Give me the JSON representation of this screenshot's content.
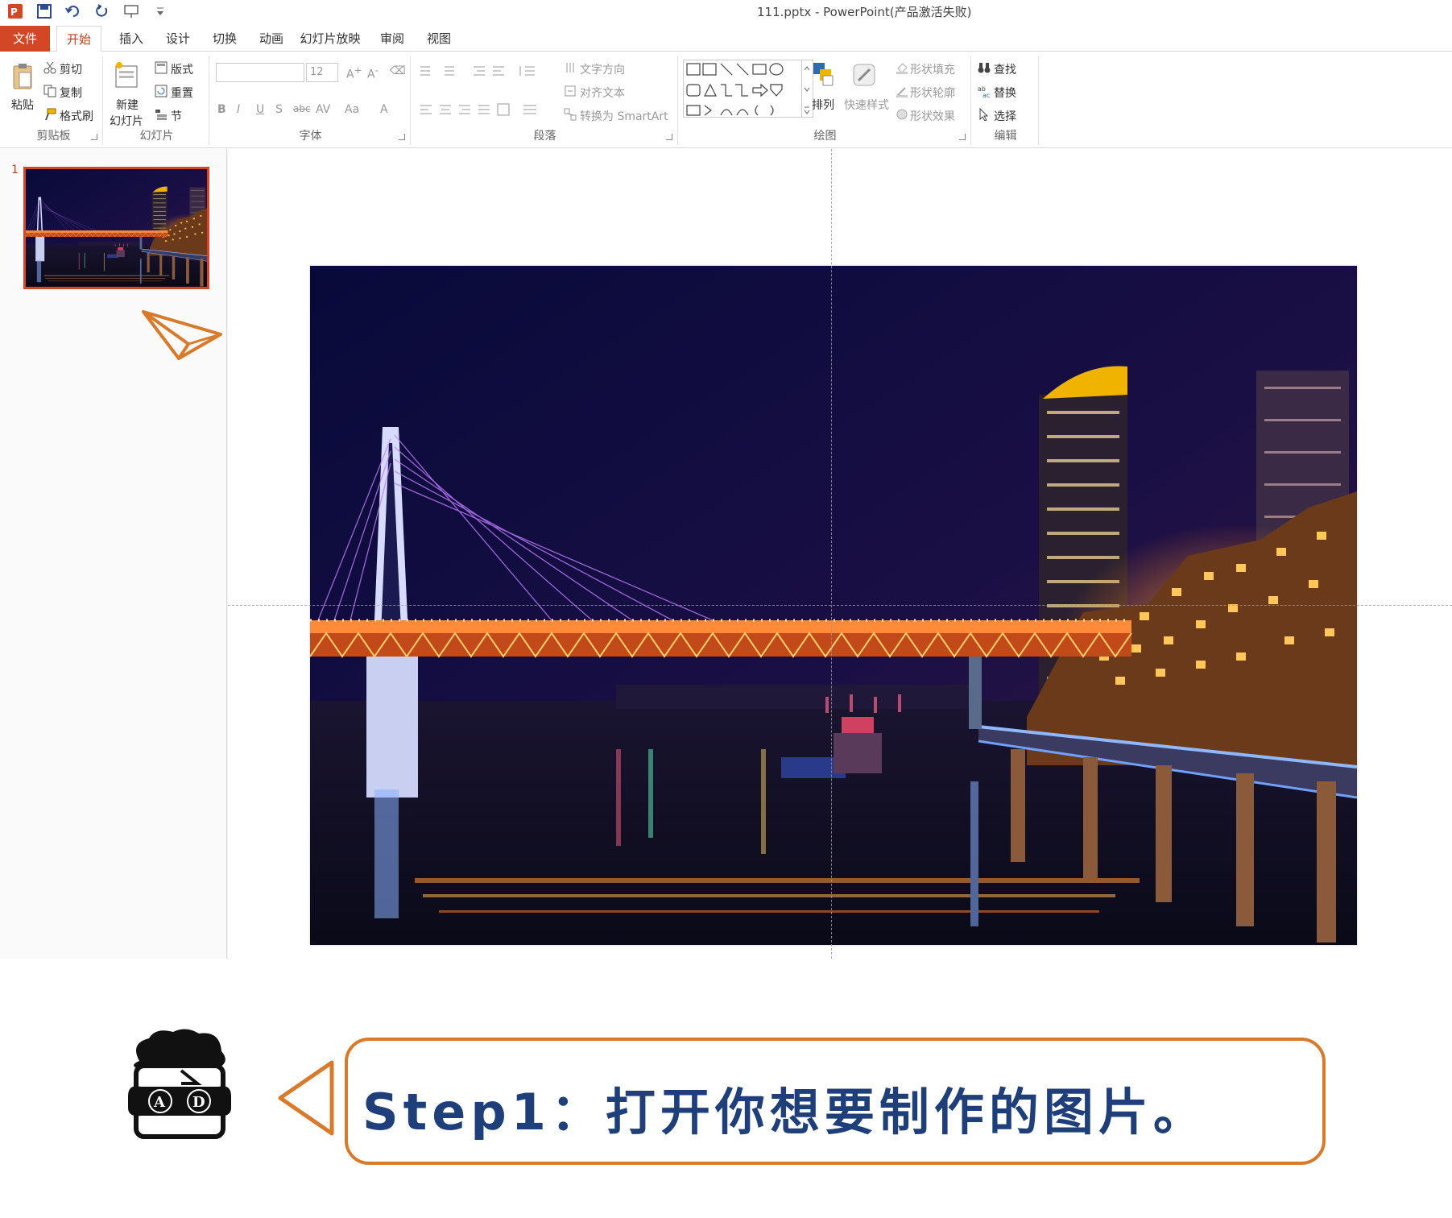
{
  "window": {
    "title": "111.pptx - PowerPoint(产品激活失败)"
  },
  "quick_access": [
    "ppt-logo-icon",
    "save-icon",
    "undo-icon",
    "redo-icon",
    "present-icon",
    "customize-icon"
  ],
  "tabs": {
    "file": "文件",
    "home": "开始",
    "insert": "插入",
    "design": "设计",
    "transitions": "切换",
    "animations": "动画",
    "slideshow": "幻灯片放映",
    "review": "审阅",
    "view": "视图"
  },
  "ribbon": {
    "clipboard": {
      "label": "剪贴板",
      "paste": "粘贴",
      "cut": "剪切",
      "copy": "复制",
      "format_painter": "格式刷"
    },
    "slides": {
      "label": "幻灯片",
      "new_slide_1": "新建",
      "new_slide_2": "幻灯片",
      "layout": "版式",
      "reset": "重置",
      "section": "节"
    },
    "font": {
      "label": "字体",
      "size": "12",
      "bold": "B",
      "italic": "I",
      "underline": "U",
      "shadow": "S",
      "strike": "abc",
      "spacing": "AV",
      "case": "Aa",
      "color": "A"
    },
    "paragraph": {
      "label": "段落",
      "text_direction": "文字方向",
      "align_text": "对齐文本",
      "convert_smartart": "转换为 SmartArt"
    },
    "drawing": {
      "label": "绘图",
      "arrange": "排列",
      "quick_styles": "快速样式",
      "shape_fill": "形状填充",
      "shape_outline": "形状轮廓",
      "shape_effects": "形状效果"
    },
    "editing": {
      "label": "编辑",
      "find": "查找",
      "replace": "替换",
      "select": "选择"
    }
  },
  "slides_panel": {
    "slide_number": "1"
  },
  "caption": {
    "step_text": "Step1：打开你想要制作的图片。",
    "mascot_letters": "A D"
  },
  "colors": {
    "accent": "#d24726",
    "caption_text": "#1f3f7a",
    "caption_border": "#d97a2b"
  }
}
